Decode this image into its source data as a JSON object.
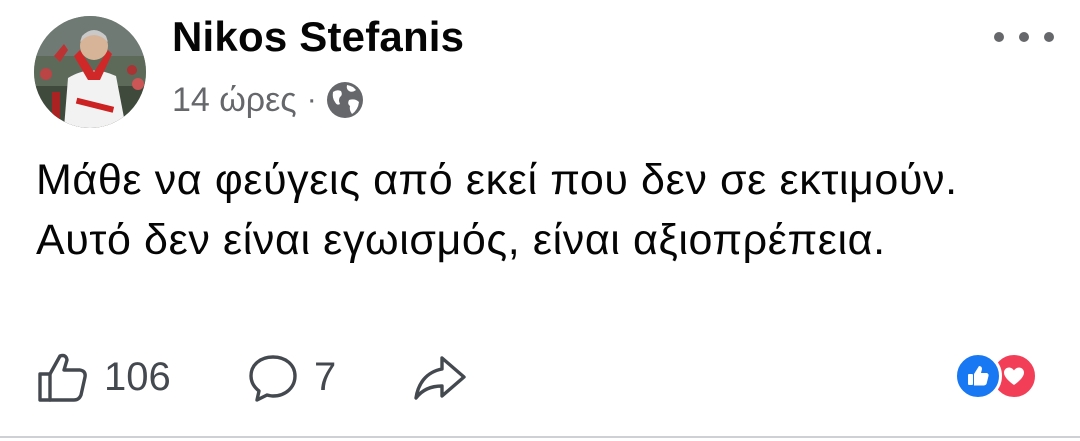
{
  "post": {
    "author_name": "Nikos Stefanis",
    "time": "14 ώρες",
    "separator": "·",
    "privacy_icon": "globe-icon",
    "more_icon": "more-horizontal-icon",
    "text": "Μάθε να φεύγεις από εκεί που δεν σε εκτιμούν. Αυτό δεν είναι εγωισμός, είναι αξιοπρέπεια."
  },
  "actions": {
    "like_icon": "thumbs-up-outline-icon",
    "like_count": "106",
    "comment_icon": "comment-bubble-icon",
    "comment_count": "7",
    "share_icon": "share-arrow-icon"
  },
  "reactions": {
    "icons": [
      "like-reaction-icon",
      "love-reaction-icon"
    ],
    "colors": {
      "like": "#1877f2",
      "love": "#f33e58"
    }
  },
  "colors": {
    "text_primary": "#050505",
    "text_secondary": "#65676b",
    "icon": "#444950",
    "divider": "#ced0d4"
  }
}
